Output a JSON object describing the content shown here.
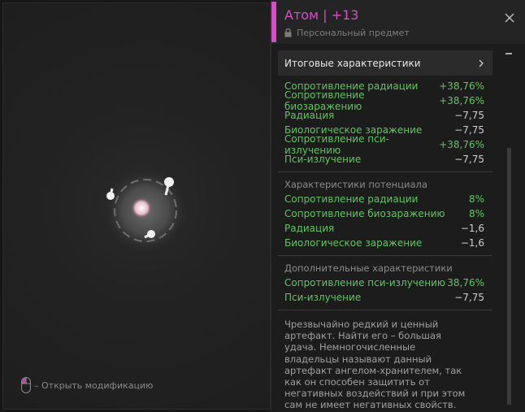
{
  "item": {
    "title": "Атом | +13",
    "subtitle": "Персональный предмет"
  },
  "hint": {
    "text": "– Открыть модификацию"
  },
  "total": {
    "header": "Итоговые характеристики",
    "rows": [
      {
        "label": "Сопротивление радиации",
        "value": "+38,76%"
      },
      {
        "label": "Сопротивление биозаражению",
        "value": "+38,76%"
      },
      {
        "label": "Радиация",
        "value": "−7,75"
      },
      {
        "label": "Биологическое заражение",
        "value": "−7,75"
      },
      {
        "label": "Сопротивление пси-излучению",
        "value": "+38,76%"
      },
      {
        "label": "Пси-излучение",
        "value": "−7,75"
      }
    ]
  },
  "potential": {
    "header": "Характеристики потенциала",
    "rows": [
      {
        "label": "Сопротивление радиации",
        "value": "8%"
      },
      {
        "label": "Сопротивление биозаражению",
        "value": "8%"
      },
      {
        "label": "Радиация",
        "value": "−1,6"
      },
      {
        "label": "Биологическое заражение",
        "value": "−1,6"
      }
    ]
  },
  "extra": {
    "header": "Дополнительные характеристики",
    "rows": [
      {
        "label": "Сопротивление пси-излучению",
        "value": "38,76%"
      },
      {
        "label": "Пси-излучение",
        "value": "−7,75"
      }
    ]
  },
  "description": "Чрезвычайно редкий и ценный артефакт. Найти его – большая удача. Немногочисленные владельцы называют данный артефакт ангелом-хранителем, так как он способен защитить от негативных воздействий и при этом сам не имеет негативных свойств.",
  "colors": {
    "accent": "#d44fc8",
    "positive": "#63c463",
    "negative_value": "#cfcfcf"
  },
  "icons": {
    "lock": "lock-icon",
    "close": "close-icon",
    "chevron": "chevron-right-icon",
    "mouse": "mouse-icon"
  }
}
